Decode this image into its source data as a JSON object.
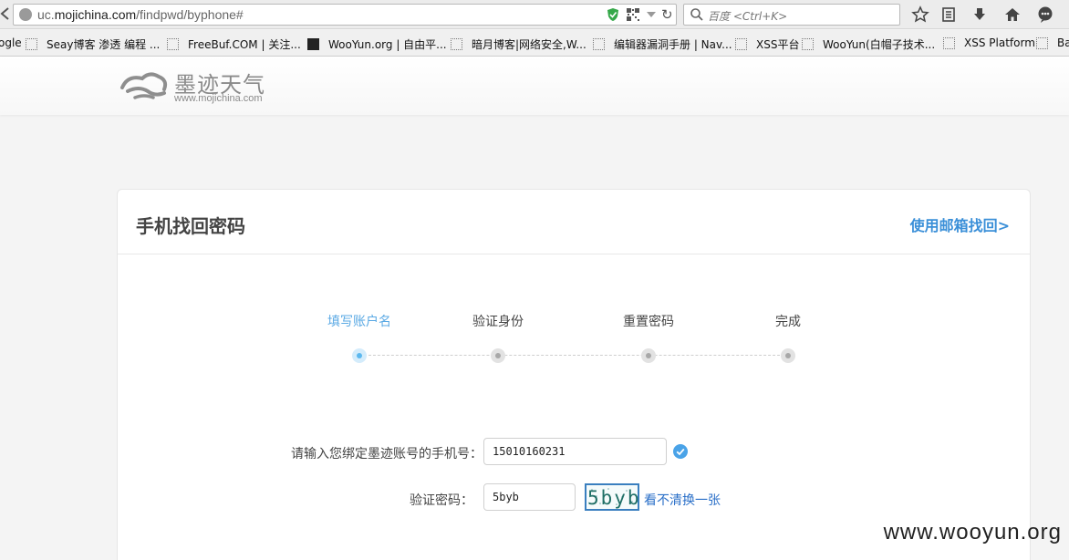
{
  "browser": {
    "url_prefix": "uc.",
    "url_host": "mojichina.com",
    "url_path": "/findpwd/byphone#",
    "search_placeholder": "百度 <Ctrl+K>"
  },
  "bookmarks": [
    "ogle",
    "Seay博客 渗透 编程 ...",
    "FreeBuf.COM | 关注...",
    "WooYun.org | 自由平...",
    "暗月博客|网络安全,W...",
    "编辑器漏洞手册 | Nav...",
    "XSS平台",
    "WooYun(白帽子技术...",
    "XSS Platform",
    "Ba"
  ],
  "site": {
    "logo_title": "墨迹天气",
    "logo_url": "www.mojichina.com"
  },
  "card": {
    "title": "手机找回密码",
    "email_link": "使用邮箱找回>"
  },
  "steps": [
    {
      "label": "填写账户名",
      "active": true
    },
    {
      "label": "验证身份",
      "active": false
    },
    {
      "label": "重置密码",
      "active": false
    },
    {
      "label": "完成",
      "active": false
    }
  ],
  "form": {
    "phone_label": "请输入您绑定墨迹账号的手机号：",
    "phone_value": "15010160231",
    "captcha_label": "验证密码：",
    "captcha_value": "5byb",
    "captcha_image_text": "5byb",
    "refresh_label": "看不清换一张"
  },
  "watermark": "www.wooyun.org",
  "colors": {
    "accent": "#3a8fd8",
    "active_step": "#5aa9e4",
    "check": "#4aa3e8"
  }
}
